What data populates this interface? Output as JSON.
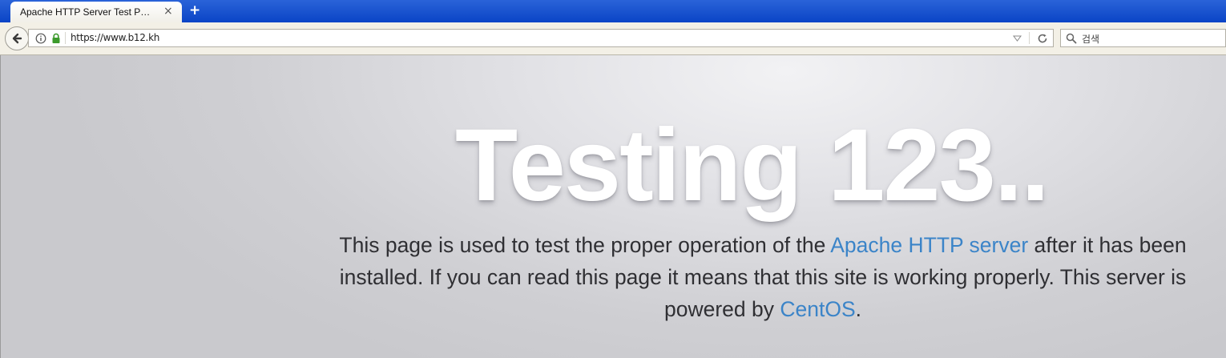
{
  "browser": {
    "tab": {
      "title": "Apache HTTP Server Test P…",
      "close_symbol": "×"
    },
    "new_tab_symbol": "+",
    "url": "https://www.b12.kh",
    "search_placeholder": "검색"
  },
  "page": {
    "heading": "Testing 123..",
    "intro": {
      "text_1": "This page is used to test the proper operation of the ",
      "link_apache": "Apache HTTP server",
      "text_2": " after it has been installed. If you can read this page it means that this site is working properly. This server is powered by ",
      "link_centos": "CentOS",
      "text_3": "."
    }
  },
  "colors": {
    "tabbar": "#0a44c6",
    "link": "#3b84c8",
    "heading": "#ffffff",
    "body_text": "#2f2f33"
  },
  "icons": [
    "back-arrow-icon",
    "info-icon",
    "lock-icon",
    "dropdown-icon",
    "reload-icon",
    "search-icon",
    "close-icon",
    "plus-icon"
  ]
}
